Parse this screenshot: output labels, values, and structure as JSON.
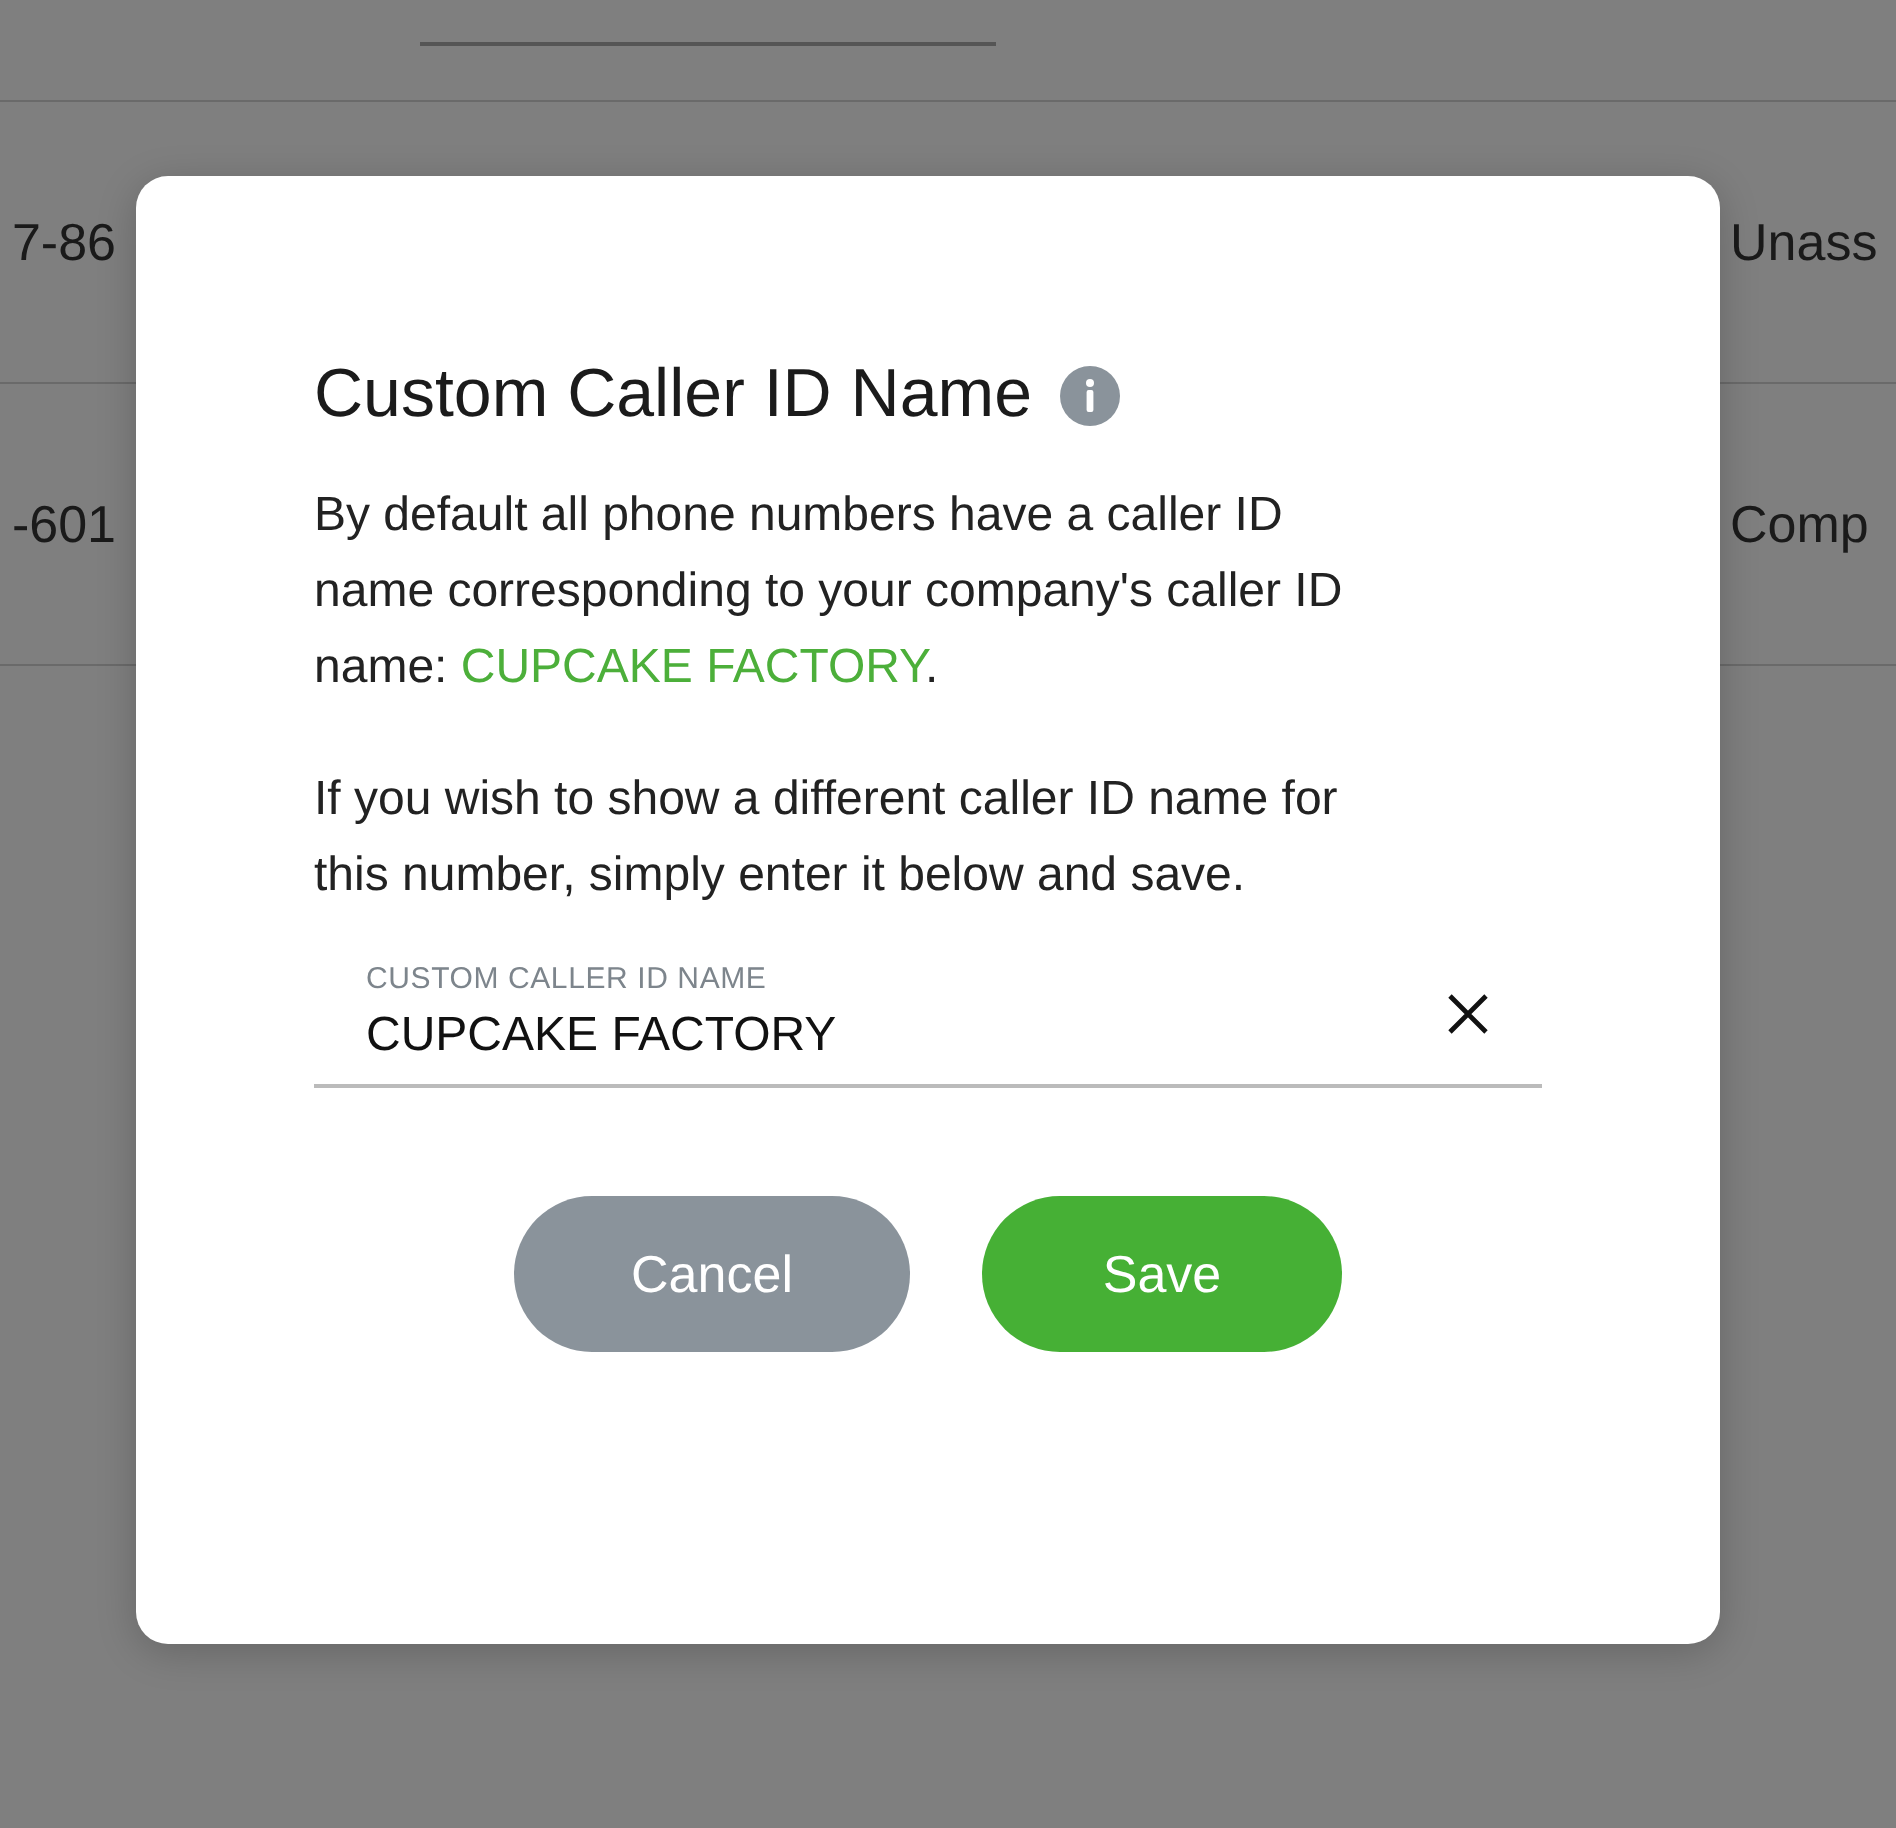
{
  "background": {
    "rows": [
      {
        "column_1": "7-86",
        "column_2": "Unass"
      },
      {
        "column_1": "-601",
        "column_2": "Comp"
      }
    ]
  },
  "dialog": {
    "title": "Custom Caller ID Name",
    "paragraphs": [
      {
        "before": "By default all phone numbers have a caller ID name corresponding to your company's caller ID name: ",
        "highlight": "CUPCAKE FACTORY",
        "after": "."
      },
      {
        "before": "If you wish to show a different caller ID name for this number, simply enter it below and save."
      }
    ],
    "field": {
      "label": "CUSTOM CALLER ID NAME",
      "value": "CUPCAKE FACTORY"
    },
    "buttons": [
      {
        "label": "Cancel",
        "kind": "secondary"
      },
      {
        "label": "Save",
        "kind": "primary"
      }
    ]
  }
}
